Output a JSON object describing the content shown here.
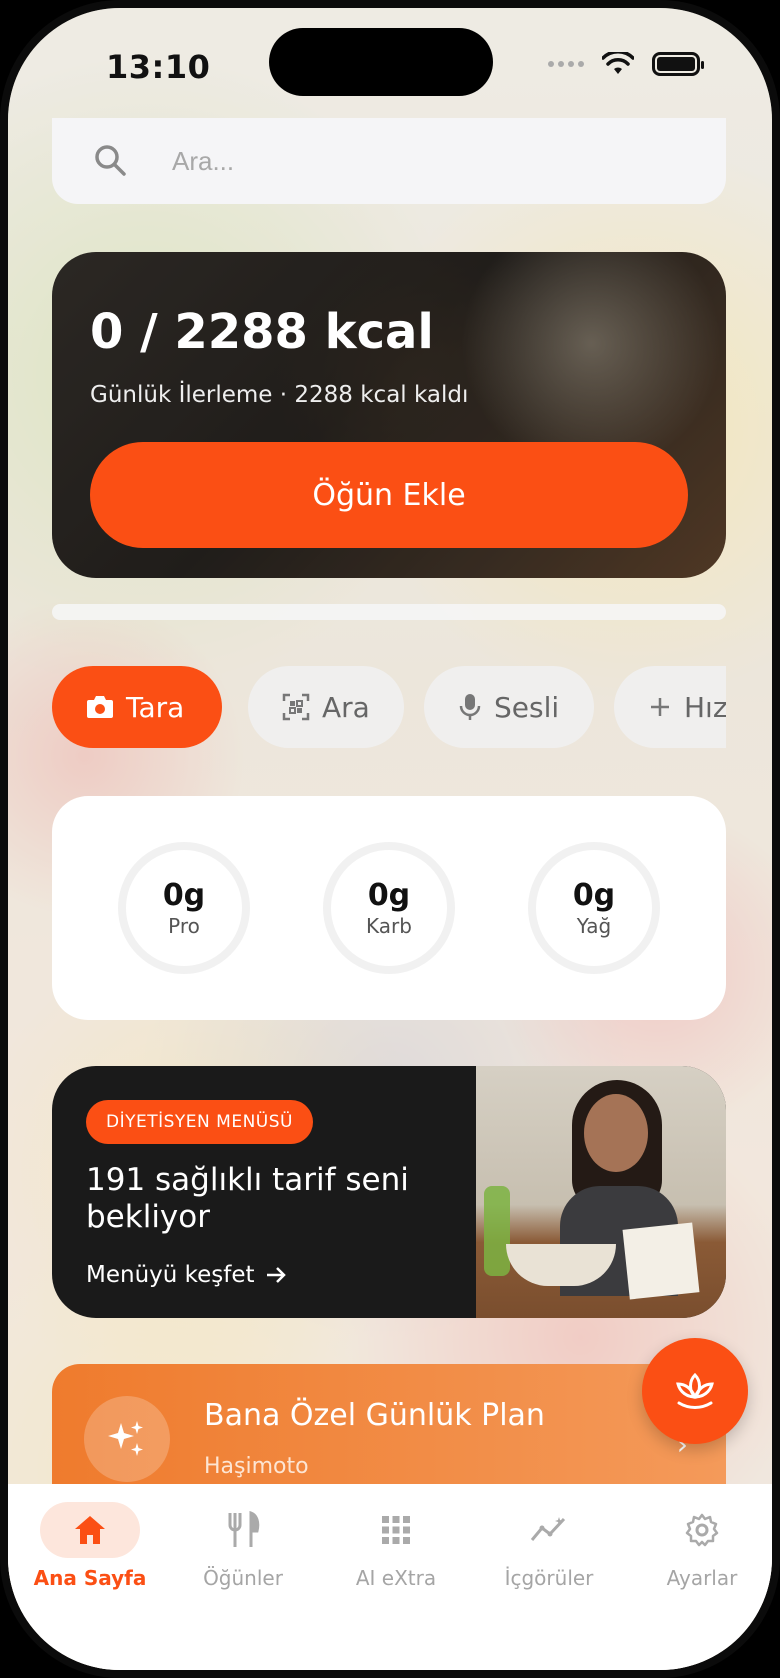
{
  "status": {
    "time": "13:10"
  },
  "search": {
    "placeholder": "Ara..."
  },
  "hero": {
    "title": "0 / 2288 kcal",
    "subtitle": "Günlük İlerleme · 2288 kcal kaldı",
    "button_label": "Öğün Ekle"
  },
  "chips": [
    {
      "label": "Tara",
      "icon": "camera-icon",
      "active": true
    },
    {
      "label": "Ara",
      "icon": "qr-scan-icon",
      "active": false
    },
    {
      "label": "Sesli",
      "icon": "microphone-icon",
      "active": false
    },
    {
      "label": "Hızl",
      "icon": "plus-icon",
      "active": false
    }
  ],
  "macros": [
    {
      "value": "0g",
      "label": "Pro"
    },
    {
      "value": "0g",
      "label": "Karb"
    },
    {
      "value": "0g",
      "label": "Yağ"
    }
  ],
  "promo": {
    "badge": "DİYETİSYEN MENÜSÜ",
    "title": "191 sağlıklı tarif seni bekliyor",
    "link": "Menüyü keşfet"
  },
  "plan": {
    "title": "Bana Özel Günlük Plan",
    "subtitle": "Haşimoto"
  },
  "tabs": [
    {
      "label": "Ana Sayfa",
      "icon": "home-icon",
      "active": true
    },
    {
      "label": "Öğünler",
      "icon": "utensils-icon",
      "active": false
    },
    {
      "label": "AI eXtra",
      "icon": "grid-icon",
      "active": false
    },
    {
      "label": "İçgörüler",
      "icon": "chart-line-icon",
      "active": false
    },
    {
      "label": "Ayarlar",
      "icon": "gear-icon",
      "active": false
    }
  ],
  "colors": {
    "accent": "#fb4f14",
    "plan_gradient_start": "#ef7b2d",
    "plan_gradient_end": "#f49a5a"
  }
}
